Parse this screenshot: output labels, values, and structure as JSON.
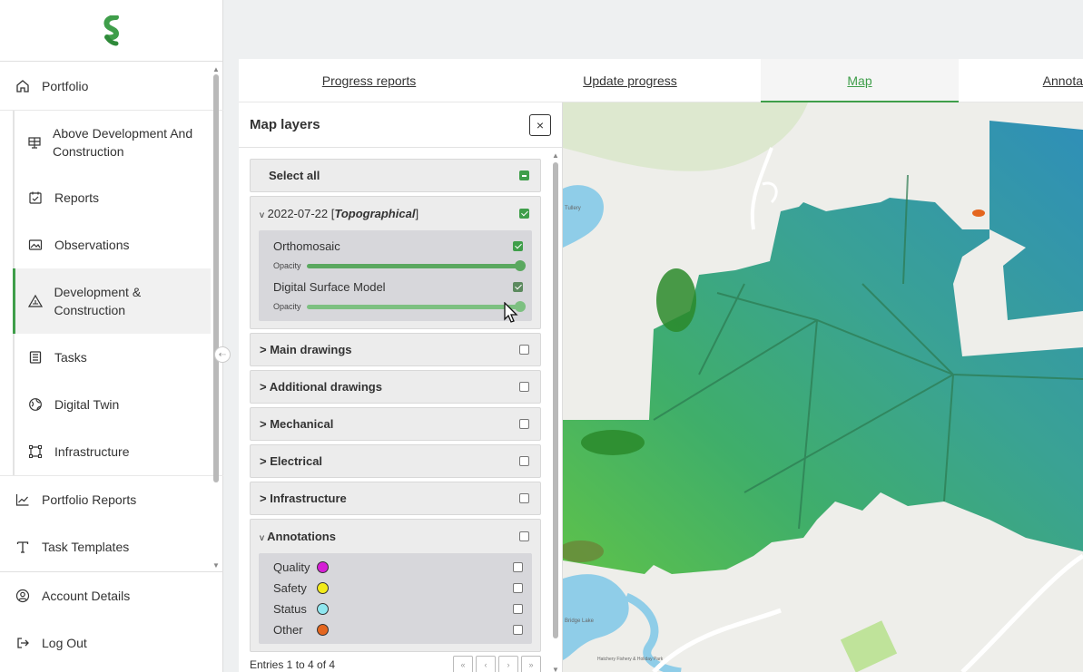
{
  "sidebar": {
    "portfolio": "Portfolio",
    "sub_items": [
      {
        "label": "Above Development And Construction"
      },
      {
        "label": "Reports"
      },
      {
        "label": "Observations"
      },
      {
        "label": "Development & Construction"
      },
      {
        "label": "Tasks"
      },
      {
        "label": "Digital Twin"
      },
      {
        "label": "Infrastructure"
      }
    ],
    "portfolio_reports": "Portfolio Reports",
    "task_templates": "Task Templates",
    "account_details": "Account Details",
    "log_out": "Log Out"
  },
  "tabs": [
    {
      "label": "Progress reports"
    },
    {
      "label": "Update progress"
    },
    {
      "label": "Map"
    },
    {
      "label": "Annota"
    }
  ],
  "layers": {
    "title": "Map layers",
    "close": "×",
    "select_all": "Select all",
    "survey": {
      "label_date": "2022-07-22",
      "label_type": "Topographical",
      "items": [
        {
          "label": "Orthomosaic",
          "opacity_label": "Opacity",
          "opacity": 1.0
        },
        {
          "label": "Digital Surface Model",
          "opacity_label": "Opacity",
          "opacity": 1.0
        }
      ]
    },
    "groups": [
      {
        "label": "Main drawings"
      },
      {
        "label": "Additional drawings"
      },
      {
        "label": "Mechanical"
      },
      {
        "label": "Electrical"
      },
      {
        "label": "Infrastructure"
      }
    ],
    "annotations": {
      "label": "Annotations",
      "items": [
        {
          "label": "Quality",
          "color": "#d61ed6"
        },
        {
          "label": "Safety",
          "color": "#f2ea1a"
        },
        {
          "label": "Status",
          "color": "#8fe6ef"
        },
        {
          "label": "Other",
          "color": "#e4661f"
        }
      ]
    },
    "entries": "Entries 1 to 4 of 4",
    "pager": [
      "«",
      "‹",
      "›",
      "»"
    ]
  },
  "map": {
    "labels": [
      "Tullery",
      "Bridge Lake",
      "Hatchery Fishery & Holiday Park"
    ]
  },
  "colors": {
    "accent": "#3f9e4a"
  }
}
